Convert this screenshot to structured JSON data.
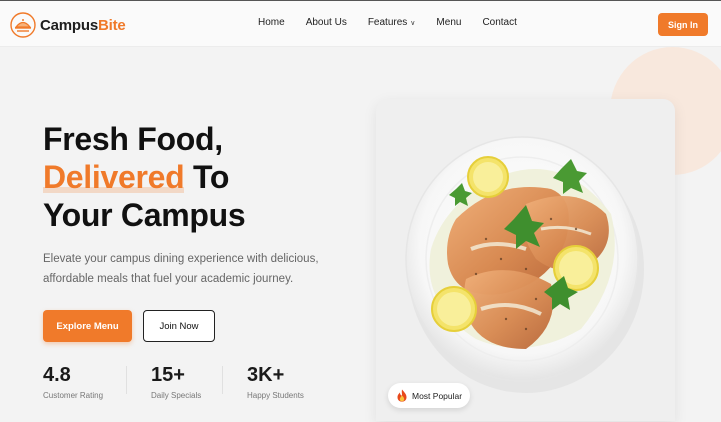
{
  "brand": {
    "name_part1": "Campus",
    "name_part2": "Bite"
  },
  "nav": {
    "items": [
      {
        "label": "Home"
      },
      {
        "label": "About Us"
      },
      {
        "label": "Features"
      },
      {
        "label": "Menu"
      },
      {
        "label": "Contact"
      }
    ],
    "features_chevron": "∨",
    "sign_in_label": "Sign In"
  },
  "hero": {
    "headline_line1": "Fresh Food,",
    "headline_accent": "Delivered",
    "headline_line2_rest": " To",
    "headline_line3": "Your Campus",
    "subtitle": "Elevate your campus dining experience with delicious, affordable meals that fuel your academic journey.",
    "primary_button": "Explore Menu",
    "secondary_button": "Join Now"
  },
  "stats": [
    {
      "value": "4.8",
      "label": "Customer Rating"
    },
    {
      "value": "15+",
      "label": "Daily Specials"
    },
    {
      "value": "3K+",
      "label": "Happy Students"
    }
  ],
  "badge": {
    "text": "Most Popular",
    "icon": "fire-icon"
  },
  "colors": {
    "accent": "#f07a2a",
    "text_dark": "#111111",
    "muted": "#666666"
  }
}
